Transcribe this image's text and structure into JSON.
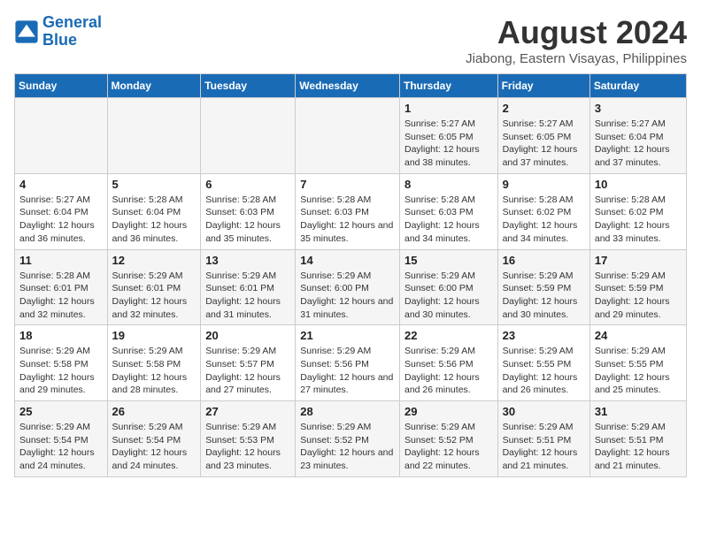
{
  "header": {
    "logo_line1": "General",
    "logo_line2": "Blue",
    "main_title": "August 2024",
    "subtitle": "Jiabong, Eastern Visayas, Philippines"
  },
  "calendar": {
    "day_headers": [
      "Sunday",
      "Monday",
      "Tuesday",
      "Wednesday",
      "Thursday",
      "Friday",
      "Saturday"
    ],
    "weeks": [
      {
        "days": [
          {
            "number": "",
            "info": ""
          },
          {
            "number": "",
            "info": ""
          },
          {
            "number": "",
            "info": ""
          },
          {
            "number": "",
            "info": ""
          },
          {
            "number": "1",
            "info": "Sunrise: 5:27 AM\nSunset: 6:05 PM\nDaylight: 12 hours and 38 minutes."
          },
          {
            "number": "2",
            "info": "Sunrise: 5:27 AM\nSunset: 6:05 PM\nDaylight: 12 hours and 37 minutes."
          },
          {
            "number": "3",
            "info": "Sunrise: 5:27 AM\nSunset: 6:04 PM\nDaylight: 12 hours and 37 minutes."
          }
        ]
      },
      {
        "days": [
          {
            "number": "4",
            "info": "Sunrise: 5:27 AM\nSunset: 6:04 PM\nDaylight: 12 hours and 36 minutes."
          },
          {
            "number": "5",
            "info": "Sunrise: 5:28 AM\nSunset: 6:04 PM\nDaylight: 12 hours and 36 minutes."
          },
          {
            "number": "6",
            "info": "Sunrise: 5:28 AM\nSunset: 6:03 PM\nDaylight: 12 hours and 35 minutes."
          },
          {
            "number": "7",
            "info": "Sunrise: 5:28 AM\nSunset: 6:03 PM\nDaylight: 12 hours and 35 minutes."
          },
          {
            "number": "8",
            "info": "Sunrise: 5:28 AM\nSunset: 6:03 PM\nDaylight: 12 hours and 34 minutes."
          },
          {
            "number": "9",
            "info": "Sunrise: 5:28 AM\nSunset: 6:02 PM\nDaylight: 12 hours and 34 minutes."
          },
          {
            "number": "10",
            "info": "Sunrise: 5:28 AM\nSunset: 6:02 PM\nDaylight: 12 hours and 33 minutes."
          }
        ]
      },
      {
        "days": [
          {
            "number": "11",
            "info": "Sunrise: 5:28 AM\nSunset: 6:01 PM\nDaylight: 12 hours and 32 minutes."
          },
          {
            "number": "12",
            "info": "Sunrise: 5:29 AM\nSunset: 6:01 PM\nDaylight: 12 hours and 32 minutes."
          },
          {
            "number": "13",
            "info": "Sunrise: 5:29 AM\nSunset: 6:01 PM\nDaylight: 12 hours and 31 minutes."
          },
          {
            "number": "14",
            "info": "Sunrise: 5:29 AM\nSunset: 6:00 PM\nDaylight: 12 hours and 31 minutes."
          },
          {
            "number": "15",
            "info": "Sunrise: 5:29 AM\nSunset: 6:00 PM\nDaylight: 12 hours and 30 minutes."
          },
          {
            "number": "16",
            "info": "Sunrise: 5:29 AM\nSunset: 5:59 PM\nDaylight: 12 hours and 30 minutes."
          },
          {
            "number": "17",
            "info": "Sunrise: 5:29 AM\nSunset: 5:59 PM\nDaylight: 12 hours and 29 minutes."
          }
        ]
      },
      {
        "days": [
          {
            "number": "18",
            "info": "Sunrise: 5:29 AM\nSunset: 5:58 PM\nDaylight: 12 hours and 29 minutes."
          },
          {
            "number": "19",
            "info": "Sunrise: 5:29 AM\nSunset: 5:58 PM\nDaylight: 12 hours and 28 minutes."
          },
          {
            "number": "20",
            "info": "Sunrise: 5:29 AM\nSunset: 5:57 PM\nDaylight: 12 hours and 27 minutes."
          },
          {
            "number": "21",
            "info": "Sunrise: 5:29 AM\nSunset: 5:56 PM\nDaylight: 12 hours and 27 minutes."
          },
          {
            "number": "22",
            "info": "Sunrise: 5:29 AM\nSunset: 5:56 PM\nDaylight: 12 hours and 26 minutes."
          },
          {
            "number": "23",
            "info": "Sunrise: 5:29 AM\nSunset: 5:55 PM\nDaylight: 12 hours and 26 minutes."
          },
          {
            "number": "24",
            "info": "Sunrise: 5:29 AM\nSunset: 5:55 PM\nDaylight: 12 hours and 25 minutes."
          }
        ]
      },
      {
        "days": [
          {
            "number": "25",
            "info": "Sunrise: 5:29 AM\nSunset: 5:54 PM\nDaylight: 12 hours and 24 minutes."
          },
          {
            "number": "26",
            "info": "Sunrise: 5:29 AM\nSunset: 5:54 PM\nDaylight: 12 hours and 24 minutes."
          },
          {
            "number": "27",
            "info": "Sunrise: 5:29 AM\nSunset: 5:53 PM\nDaylight: 12 hours and 23 minutes."
          },
          {
            "number": "28",
            "info": "Sunrise: 5:29 AM\nSunset: 5:52 PM\nDaylight: 12 hours and 23 minutes."
          },
          {
            "number": "29",
            "info": "Sunrise: 5:29 AM\nSunset: 5:52 PM\nDaylight: 12 hours and 22 minutes."
          },
          {
            "number": "30",
            "info": "Sunrise: 5:29 AM\nSunset: 5:51 PM\nDaylight: 12 hours and 21 minutes."
          },
          {
            "number": "31",
            "info": "Sunrise: 5:29 AM\nSunset: 5:51 PM\nDaylight: 12 hours and 21 minutes."
          }
        ]
      }
    ]
  }
}
